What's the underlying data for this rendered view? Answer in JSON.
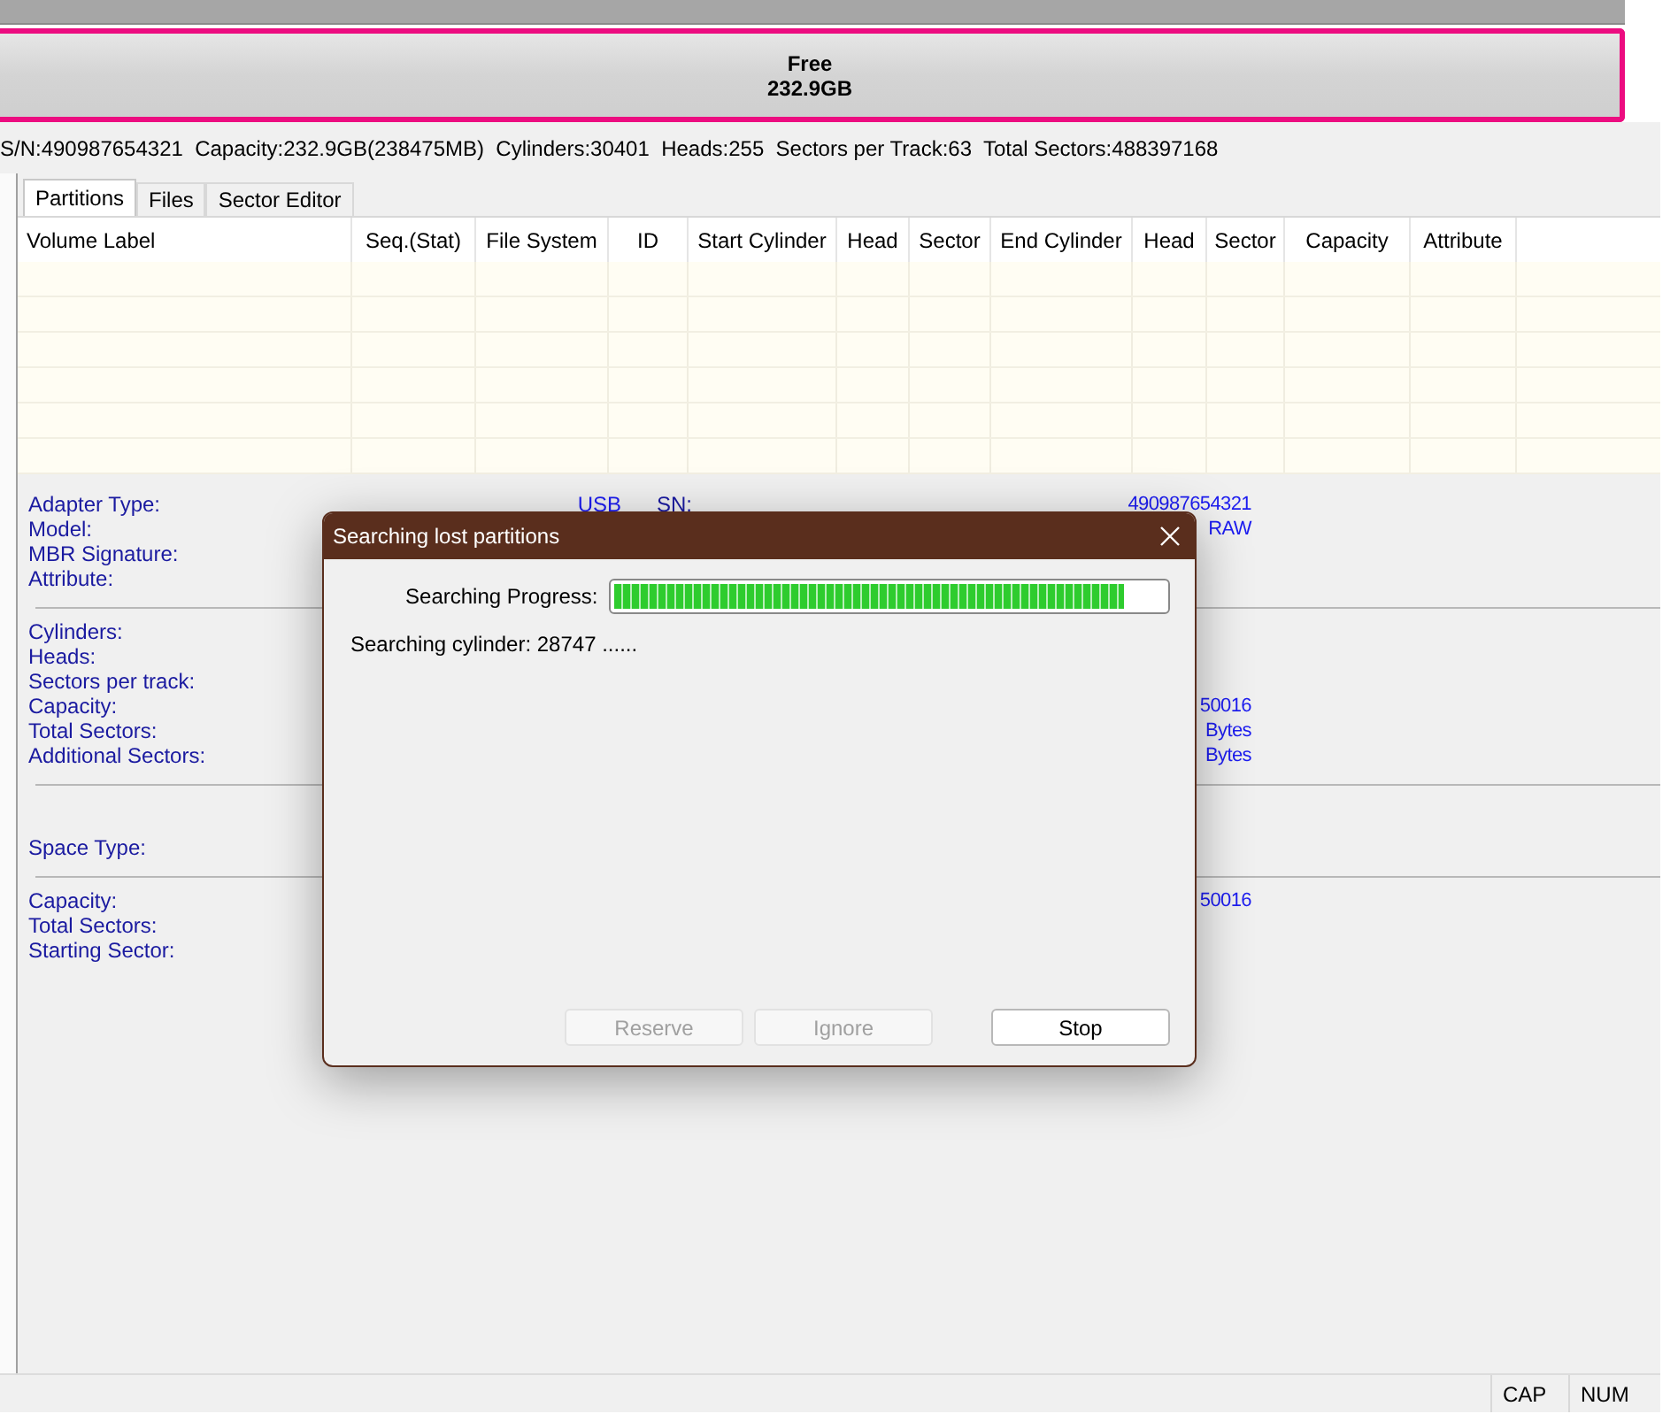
{
  "disk_map": {
    "label": "Free",
    "size": "232.9GB"
  },
  "disk_info": "S/N:490987654321  Capacity:232.9GB(238475MB)  Cylinders:30401  Heads:255  Sectors per Track:63  Total Sectors:488397168",
  "tabs": [
    {
      "label": "Partitions",
      "selected": true
    },
    {
      "label": "Files",
      "selected": false
    },
    {
      "label": "Sector Editor",
      "selected": false
    }
  ],
  "table": {
    "columns": [
      "Volume Label",
      "Seq.(Stat)",
      "File System",
      "ID",
      "Start Cylinder",
      "Head",
      "Sector",
      "End Cylinder",
      "Head",
      "Sector",
      "Capacity",
      "Attribute"
    ]
  },
  "details": [
    {
      "rows": [
        {
          "label": "Adapter Type:",
          "value": "USB",
          "key2": "SN:",
          "value2": "490987654321"
        },
        {
          "label": "Model:",
          "value2": "RAW"
        },
        {
          "label": "MBR Signature:"
        },
        {
          "label": "Attribute:"
        }
      ]
    },
    {
      "rows": [
        {
          "label": "Cylinders:"
        },
        {
          "label": "Heads:"
        },
        {
          "label": "Sectors per track:"
        },
        {
          "label": "Capacity:",
          "value2": "50016"
        },
        {
          "label": "Total Sectors:",
          "value2": "Bytes"
        },
        {
          "label": "Additional Sectors:",
          "value2": "Bytes"
        }
      ]
    },
    {
      "rows": [
        {
          "label": "Space Type:"
        }
      ]
    },
    {
      "rows": [
        {
          "label": "Capacity:",
          "value2": "50016"
        },
        {
          "label": "Total Sectors:"
        },
        {
          "label": "Starting Sector:"
        }
      ]
    }
  ],
  "dialog": {
    "title": "Searching lost partitions",
    "progress_label": "Searching Progress:",
    "level": 0.925,
    "status": "Searching cylinder: 28747 ......",
    "buttons": [
      {
        "label": "Reserve",
        "disabled": true
      },
      {
        "label": "Ignore",
        "disabled": true
      },
      {
        "label": "Stop",
        "disabled": false
      }
    ]
  },
  "status_bar": [
    "CAP",
    "NUM"
  ]
}
